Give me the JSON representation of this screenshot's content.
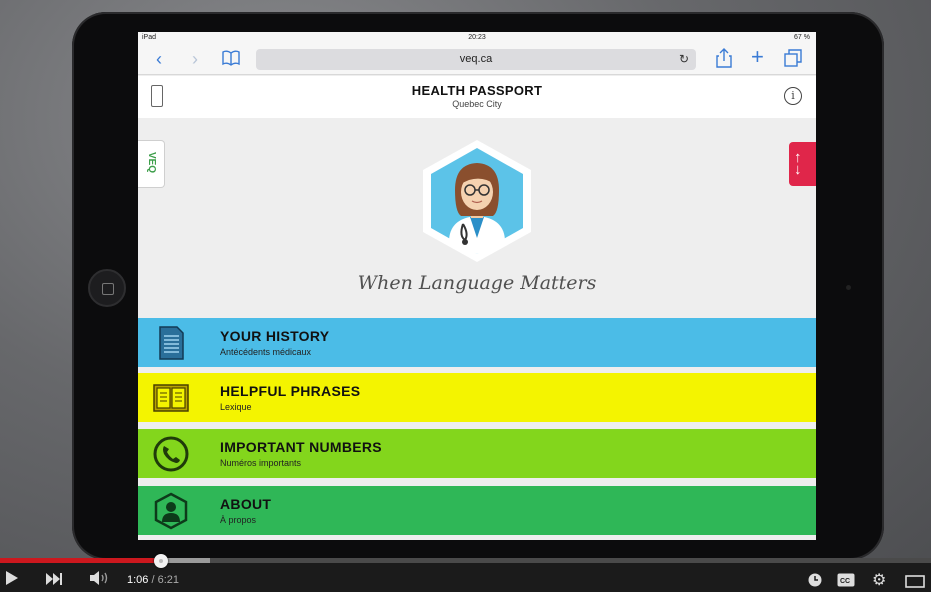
{
  "status_bar": {
    "device": "iPad",
    "time": "20:23",
    "battery": "67 %"
  },
  "browser": {
    "url": "veq.ca"
  },
  "app_header": {
    "title": "HEALTH PASSPORT",
    "subtitle": "Quebec City"
  },
  "hero": {
    "side_tab": "VEQ",
    "tagline": "When Language Matters"
  },
  "menu": [
    {
      "title": "YOUR HISTORY",
      "subtitle": "Antécédents médicaux",
      "color": "#4bbce7",
      "icon": "document-icon"
    },
    {
      "title": "HELPFUL PHRASES",
      "subtitle": "Lexique",
      "color": "#f4f400",
      "icon": "book-icon"
    },
    {
      "title": "IMPORTANT NUMBERS",
      "subtitle": "Numéros importants",
      "color": "#83d61c",
      "icon": "phone-icon"
    },
    {
      "title": "ABOUT",
      "subtitle": "À propos",
      "color": "#2fb757",
      "icon": "person-icon"
    }
  ],
  "player": {
    "current_time": "1:06",
    "duration": "6:21",
    "progress": 0.173
  }
}
